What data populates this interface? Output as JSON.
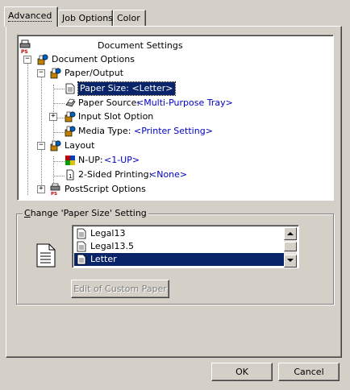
{
  "tabs": [
    "Advanced",
    "Job Options",
    "Color"
  ],
  "tree": {
    "root": "Document Settings",
    "document_options": "Document Options",
    "paper_output": "Paper/Output",
    "paper_size_label": "Paper Size:",
    "paper_size_value": "<Letter>",
    "paper_source_label": "Paper Source:",
    "paper_source_value": "<Multi-Purpose Tray>",
    "input_slot": "Input Slot Option",
    "media_type_label": "Media Type:",
    "media_type_value": "<Printer Setting>",
    "layout": "Layout",
    "nup_label": "N-UP:",
    "nup_value": "<1-UP>",
    "two_sided_label": "2-Sided Printing:",
    "two_sided_value": "<None>",
    "postscript": "PostScript Options"
  },
  "group": {
    "title_first": "C",
    "title_rest": "hange 'Paper Size' Setting",
    "items": [
      "Legal13",
      "Legal13.5",
      "Letter"
    ],
    "selected": "Letter",
    "custom_button": "Edit of Custom Paper"
  },
  "footer": {
    "ok": "OK",
    "cancel": "Cancel"
  }
}
